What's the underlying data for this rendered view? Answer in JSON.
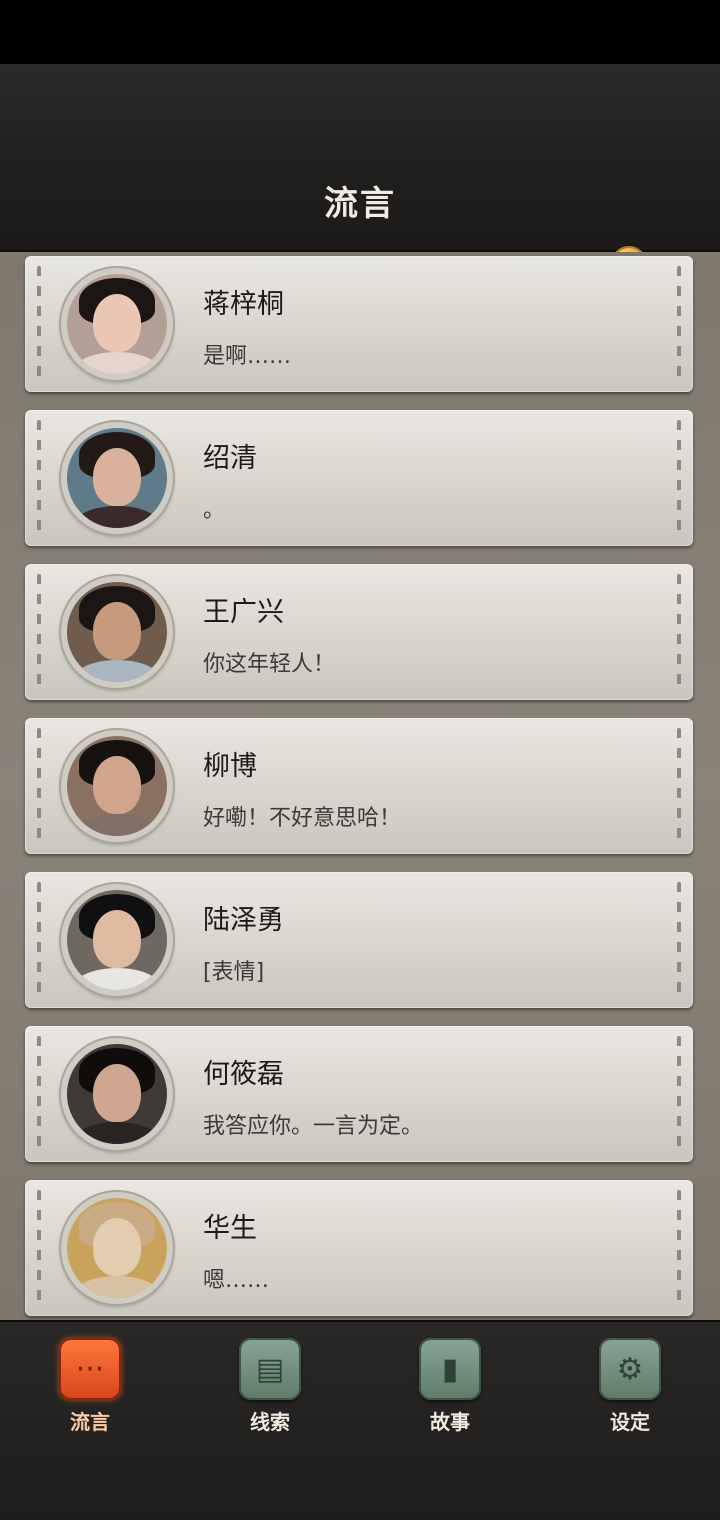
{
  "header": {
    "title": "流言",
    "coin_icon": "infinity-coin-icon",
    "coin_symbol": "∞"
  },
  "contacts": [
    {
      "name": "蒋梓桐",
      "message": "是啊……",
      "avatar": {
        "skin": "#e9c7b4",
        "hair": "#1b1513",
        "body": "#e5d5cc",
        "bg": "#b39f95"
      }
    },
    {
      "name": "绍清",
      "message": "。",
      "avatar": {
        "skin": "#d9b19c",
        "hair": "#231a17",
        "body": "#3a2b2a",
        "bg": "#5f7a88"
      }
    },
    {
      "name": "王广兴",
      "message": "你这年轻人！",
      "avatar": {
        "skin": "#c79a7e",
        "hair": "#1a1614",
        "body": "#aab7c2",
        "bg": "#6f5c4d"
      }
    },
    {
      "name": "柳博",
      "message": "好嘞！不好意思哈！",
      "avatar": {
        "skin": "#d1a58b",
        "hair": "#161210",
        "body": "#7f6f65",
        "bg": "#8a7262"
      }
    },
    {
      "name": "陆泽勇",
      "message": "[表情]",
      "avatar": {
        "skin": "#e0b9a1",
        "hair": "#111010",
        "body": "#e8e6e2",
        "bg": "#6d6861"
      }
    },
    {
      "name": "何筱磊",
      "message": "我答应你。一言为定。",
      "avatar": {
        "skin": "#cfa68f",
        "hair": "#0f0d0c",
        "body": "#2a2523",
        "bg": "#3f3a36"
      }
    },
    {
      "name": "华生",
      "message": "嗯……",
      "avatar": {
        "skin": "#e3cdb1",
        "hair": "#c9ab86",
        "body": "#d8c2a4",
        "bg": "#c9a25b"
      }
    }
  ],
  "tabs": [
    {
      "label": "流言",
      "icon": "chat-bubble-icon",
      "glyph": "···",
      "active": true
    },
    {
      "label": "线索",
      "icon": "papers-icon",
      "glyph": "▤",
      "active": false
    },
    {
      "label": "故事",
      "icon": "book-icon",
      "glyph": "▮",
      "active": false
    },
    {
      "label": "设定",
      "icon": "gear-icon",
      "glyph": "⚙",
      "active": false
    }
  ]
}
